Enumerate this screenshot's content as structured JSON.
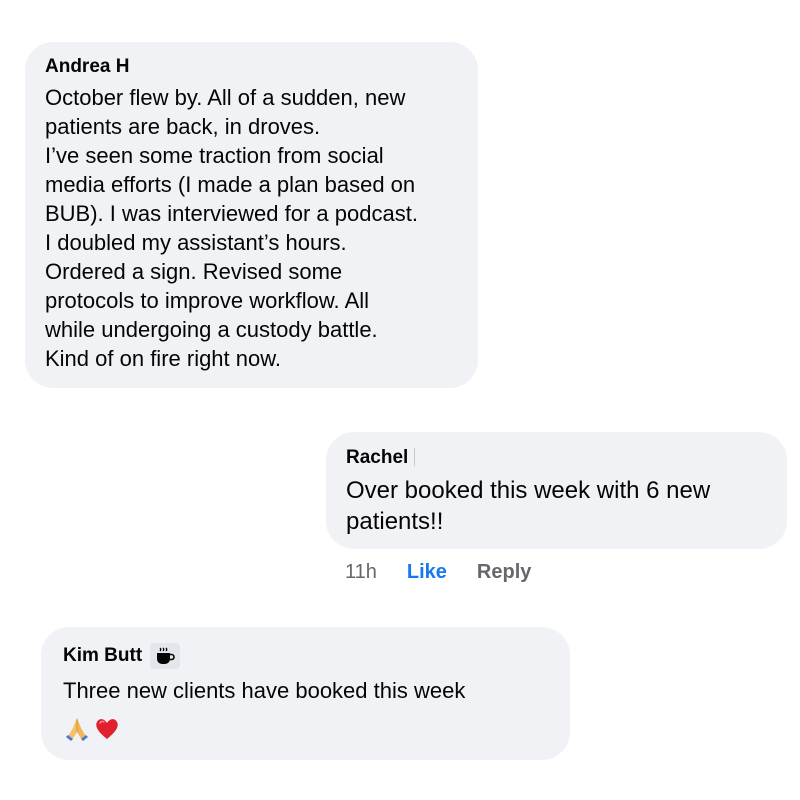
{
  "comments": [
    {
      "author": "Andrea H",
      "lines": [
        "October flew by. All of a sudden, new",
        "patients are back, in droves.",
        "I’ve seen some traction from social",
        "media efforts (I made a plan based on",
        "BUB). I was interviewed for a podcast.",
        "I doubled my assistant’s hours.",
        "Ordered a sign. Revised some",
        "protocols to improve workflow. All",
        "while undergoing a custody battle.",
        "Kind of on fire right now."
      ]
    },
    {
      "author": "Rachel",
      "lines": [
        "Over booked this week with 6 new",
        "patients!!"
      ],
      "time": "11h",
      "like_label": "Like",
      "reply_label": "Reply"
    },
    {
      "author": "Kim Butt",
      "badge_icon": "coffee-icon",
      "lines": [
        "Three new clients have booked this week"
      ],
      "emojis": [
        "praying-hands-icon",
        "red-heart-icon"
      ]
    }
  ],
  "colors": {
    "bubble": "#f0f2f5",
    "text": "#050505",
    "muted": "#65676b",
    "like": "#1877f2"
  }
}
